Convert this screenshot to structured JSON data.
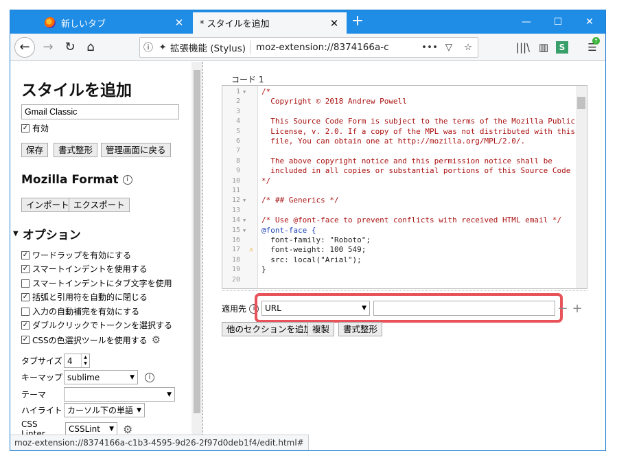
{
  "browser": {
    "tabs": [
      {
        "title": "新しいタブ",
        "active": false
      },
      {
        "title": "* スタイルを追加",
        "active": true
      }
    ],
    "identity": "拡張機能 (Stylus)",
    "url": "moz-extension://8374166a-c",
    "status_url": "moz-extension://8374166a-c1b3-4595-9d26-2f97d0deb1f4/edit.html#",
    "accent": "#1f8ce6"
  },
  "left": {
    "heading": "スタイルを追加",
    "name_value": "Gmail Classic",
    "enabled_label": "有効",
    "buttons": {
      "save": "保存",
      "beautify": "書式整形",
      "back": "管理画面に戻る"
    },
    "format_heading": "Mozilla Format",
    "import_label": "インポート",
    "export_label": "エクスポート",
    "options_heading": "オプション",
    "options": [
      {
        "label": "ワードラップを有効にする",
        "checked": true
      },
      {
        "label": "スマートインデントを使用する",
        "checked": true
      },
      {
        "label": "スマートインデントにタブ文字を使用",
        "checked": false
      },
      {
        "label": "括弧と引用符を自動的に閉じる",
        "checked": true
      },
      {
        "label": "入力の自動補完を有効にする",
        "checked": false
      },
      {
        "label": "ダブルクリックでトークンを選択する",
        "checked": true
      },
      {
        "label": "CSSの色選択ツールを使用する",
        "checked": true
      }
    ],
    "tabsize_label": "タブサイズ",
    "tabsize_value": "4",
    "keymap_label": "キーマップ",
    "keymap_value": "sublime",
    "theme_label": "テーマ",
    "theme_value": "",
    "highlight_label": "ハイライト",
    "highlight_value": "カーソル下の単語",
    "linter_label": "CSS Linter",
    "linter_value": "CSSLint"
  },
  "editor": {
    "section_label": "コード 1",
    "lines": [
      {
        "n": "1",
        "text": "/*",
        "fold": true
      },
      {
        "n": "2",
        "text": "  Copyright © 2018 Andrew Powell"
      },
      {
        "n": "3",
        "text": ""
      },
      {
        "n": "4",
        "text": "  This Source Code Form is subject to the terms of the Mozilla Public"
      },
      {
        "n": "5",
        "text": "  License, v. 2.0. If a copy of the MPL was not distributed with this"
      },
      {
        "n": "6",
        "text": "  file, You can obtain one at http://mozilla.org/MPL/2.0/."
      },
      {
        "n": "7",
        "text": ""
      },
      {
        "n": "8",
        "text": "  The above copyright notice and this permission notice shall be"
      },
      {
        "n": "9",
        "text": "  included in all copies or substantial portions of this Source Code Form."
      },
      {
        "n": "10",
        "text": "*/"
      },
      {
        "n": "11",
        "text": ""
      },
      {
        "n": "12",
        "text": "/* ## Generics */",
        "fold": true
      },
      {
        "n": "13",
        "text": ""
      },
      {
        "n": "14",
        "text": "/* Use @font-face to prevent conflicts with received HTML email */",
        "fold": true
      },
      {
        "n": "15",
        "text": "@font-face {",
        "fold": true
      },
      {
        "n": "16",
        "text": "  font-family: \"Roboto\";"
      },
      {
        "n": "17",
        "text": "  font-weight: 100 549;",
        "warning": true
      },
      {
        "n": "18",
        "text": "  src: local(\"Arial\");"
      },
      {
        "n": "19",
        "text": "}"
      },
      {
        "n": "20",
        "text": ""
      }
    ],
    "applies_label": "適用先",
    "applies_type": "URL",
    "applies_value": "",
    "add_section_label": "他のセクションを追加",
    "clone_label": "複製",
    "beautify_label": "書式整形"
  }
}
